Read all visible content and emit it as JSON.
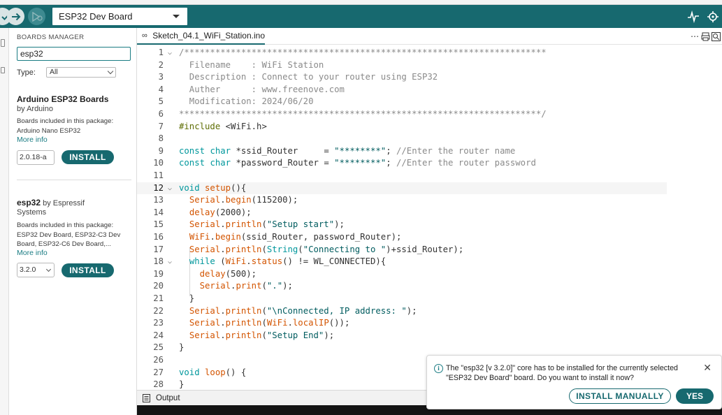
{
  "toolbar": {
    "board_selected": "ESP32 Dev Board",
    "icons": [
      "verify-icon",
      "upload-icon",
      "debug-icon",
      "serial-plotter-icon",
      "serial-monitor-icon"
    ]
  },
  "boards_manager": {
    "title": "BOARDS MANAGER",
    "search_value": "esp32",
    "type_label": "Type:",
    "type_value": "All",
    "packages": [
      {
        "name": "Arduino ESP32 Boards",
        "by_prefix": "",
        "by": "by Arduino",
        "desc": "Boards included in this package: Arduino Nano ESP32",
        "more": "More info",
        "version": "2.0.18-a",
        "install": "INSTALL"
      },
      {
        "name": "esp32",
        "by_prefix": " by Espressif",
        "by": "Systems",
        "desc": "Boards included in this package: ESP32 Dev Board, ESP32-C3 Dev Board, ESP32-C6 Dev Board,...",
        "more": "More info",
        "version": "3.2.0",
        "install": "INSTALL"
      }
    ]
  },
  "editor": {
    "tab_label": "Sketch_04.1_WiFi_Station.ino",
    "line_numbers": [
      "1",
      "2",
      "3",
      "4",
      "5",
      "6",
      "7",
      "8",
      "9",
      "10",
      "11",
      "12",
      "13",
      "14",
      "15",
      "16",
      "17",
      "18",
      "19",
      "20",
      "21",
      "22",
      "23",
      "24",
      "25",
      "26",
      "27",
      "28"
    ],
    "code": {
      "l1": "/**********************************************************************",
      "l2": "  Filename    : WiFi Station",
      "l3": "  Description : Connect to your router using ESP32",
      "l4": "  Auther      : www.freenove.com",
      "l5": "  Modification: 2024/06/20",
      "l6": "**********************************************************************/",
      "l7a": "#include",
      "l7b": " <WiFi.h>",
      "l9a": "const",
      "l9b": " ",
      "l9c": "char",
      "l9d": " *ssid_Router     = ",
      "l9e": "\"********\"",
      "l9f": "; ",
      "l9g": "//Enter the router name",
      "l10a": "const",
      "l10b": " ",
      "l10c": "char",
      "l10d": " *password_Router = ",
      "l10e": "\"********\"",
      "l10f": "; ",
      "l10g": "//Enter the router password",
      "l12a": "void",
      "l12b": " ",
      "l12c": "setup",
      "l12d": "(){",
      "l13a": "  ",
      "l13b": "Serial",
      "l13c": ".",
      "l13d": "begin",
      "l13e": "(115200);",
      "l14a": "  ",
      "l14b": "delay",
      "l14c": "(2000);",
      "l15a": "  ",
      "l15b": "Serial",
      "l15c": ".",
      "l15d": "println",
      "l15e": "(",
      "l15f": "\"Setup start\"",
      "l15g": ");",
      "l16a": "  ",
      "l16b": "WiFi",
      "l16c": ".",
      "l16d": "begin",
      "l16e": "(ssid_Router, password_Router);",
      "l17a": "  ",
      "l17b": "Serial",
      "l17c": ".",
      "l17d": "println",
      "l17e": "(",
      "l17f": "String",
      "l17g": "(",
      "l17h": "\"Connecting to \"",
      "l17i": ")+ssid_Router);",
      "l18a": "  ",
      "l18b": "while",
      "l18c": " (",
      "l18d": "WiFi",
      "l18e": ".",
      "l18f": "status",
      "l18g": "() != WL_CONNECTED){",
      "l19a": "    ",
      "l19b": "delay",
      "l19c": "(500);",
      "l20a": "    ",
      "l20b": "Serial",
      "l20c": ".",
      "l20d": "print",
      "l20e": "(",
      "l20f": "\".\"",
      "l20g": ");",
      "l21": "  }",
      "l22a": "  ",
      "l22b": "Serial",
      "l22c": ".",
      "l22d": "println",
      "l22e": "(",
      "l22f": "\"\\nConnected, IP address: \"",
      "l22g": ");",
      "l23a": "  ",
      "l23b": "Serial",
      "l23c": ".",
      "l23d": "println",
      "l23e": "(",
      "l23f": "WiFi",
      "l23g": ".",
      "l23h": "localIP",
      "l23i": "());",
      "l24a": "  ",
      "l24b": "Serial",
      "l24c": ".",
      "l24d": "println",
      "l24e": "(",
      "l24f": "\"Setup End\"",
      "l24g": ");",
      "l25": "}",
      "l27a": "void",
      "l27b": " ",
      "l27c": "loop",
      "l27d": "() {",
      "l28": "}"
    }
  },
  "output": {
    "label": "Output"
  },
  "notification": {
    "message": "The \"esp32 [v 3.2.0]\" core has to be installed for the currently selected \"ESP32 Dev Board\" board. Do you want to install it now?",
    "install_manually": "INSTALL MANUALLY",
    "yes": "YES"
  },
  "colors": {
    "accent": "#17696f",
    "keyword": "#00979c",
    "function": "#d35400",
    "string": "#005c5f",
    "comment": "#8a8a8a",
    "preprocessor": "#5e6d03"
  }
}
